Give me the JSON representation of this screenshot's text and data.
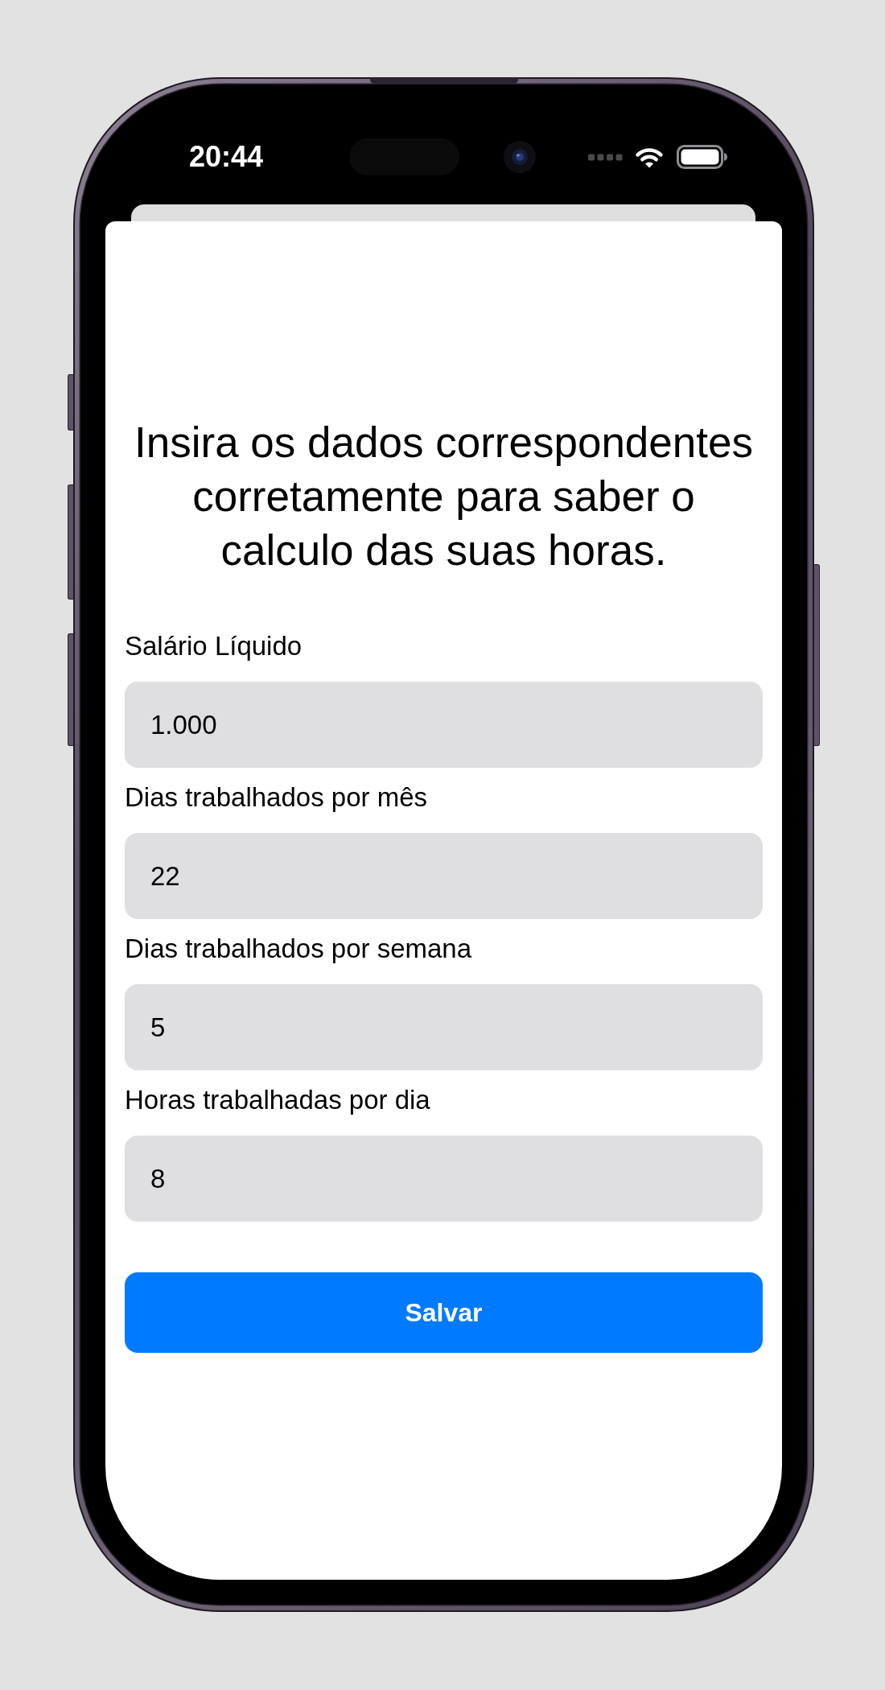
{
  "status_bar": {
    "time": "20:44"
  },
  "sheet": {
    "heading": "Insira os dados correspondentes corretamente para saber o calculo das suas horas.",
    "fields": [
      {
        "label": "Salário Líquido",
        "value": "1.000"
      },
      {
        "label": "Dias trabalhados por mês",
        "value": "22"
      },
      {
        "label": "Dias trabalhados por semana",
        "value": "5"
      },
      {
        "label": "Horas trabalhadas por dia",
        "value": "8"
      }
    ],
    "button": {
      "label": "Salvar"
    }
  }
}
